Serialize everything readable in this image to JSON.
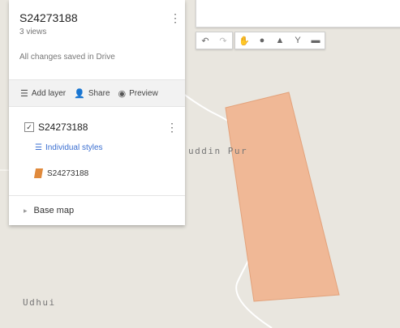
{
  "map": {
    "place_label_1": "uddin Pur",
    "place_label_2": "Udhui",
    "polygon_color": "#f0b896",
    "polygon_stroke": "#e3a27b"
  },
  "panel": {
    "title": "S24273188",
    "views": "3 views",
    "saved_status": "All changes saved in Drive",
    "actions": {
      "add_layer": "Add layer",
      "share": "Share",
      "preview": "Preview"
    },
    "layer": {
      "name": "S24273188",
      "styles_link": "Individual styles",
      "feature_name": "S24273188"
    },
    "base_map_label": "Base map"
  },
  "toolbar": {
    "tools": [
      "undo-icon",
      "redo-icon",
      "hand-icon",
      "marker-icon",
      "draw-line-icon",
      "directions-icon",
      "ruler-icon"
    ]
  }
}
